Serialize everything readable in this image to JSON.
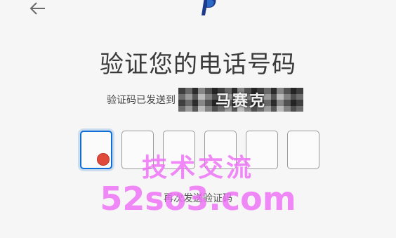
{
  "header": {
    "back_icon": "arrow-left-icon",
    "logo_icon": "paypal-logo-icon"
  },
  "main": {
    "title": "验证您的电话号码",
    "sent_to_label": "验证码已发送到",
    "phone_mask_overlay": "马赛克",
    "otp_fields": [
      "",
      "",
      "",
      "",
      "",
      ""
    ],
    "focused_index": 0,
    "resend_label": "再次发送验证码"
  },
  "watermark": {
    "line1": "技术交流",
    "line2": "52so3.com"
  },
  "colors": {
    "focus_border": "#0f6fd6",
    "watermark": "#ee6ef5",
    "logo": "#1d3b8a"
  }
}
